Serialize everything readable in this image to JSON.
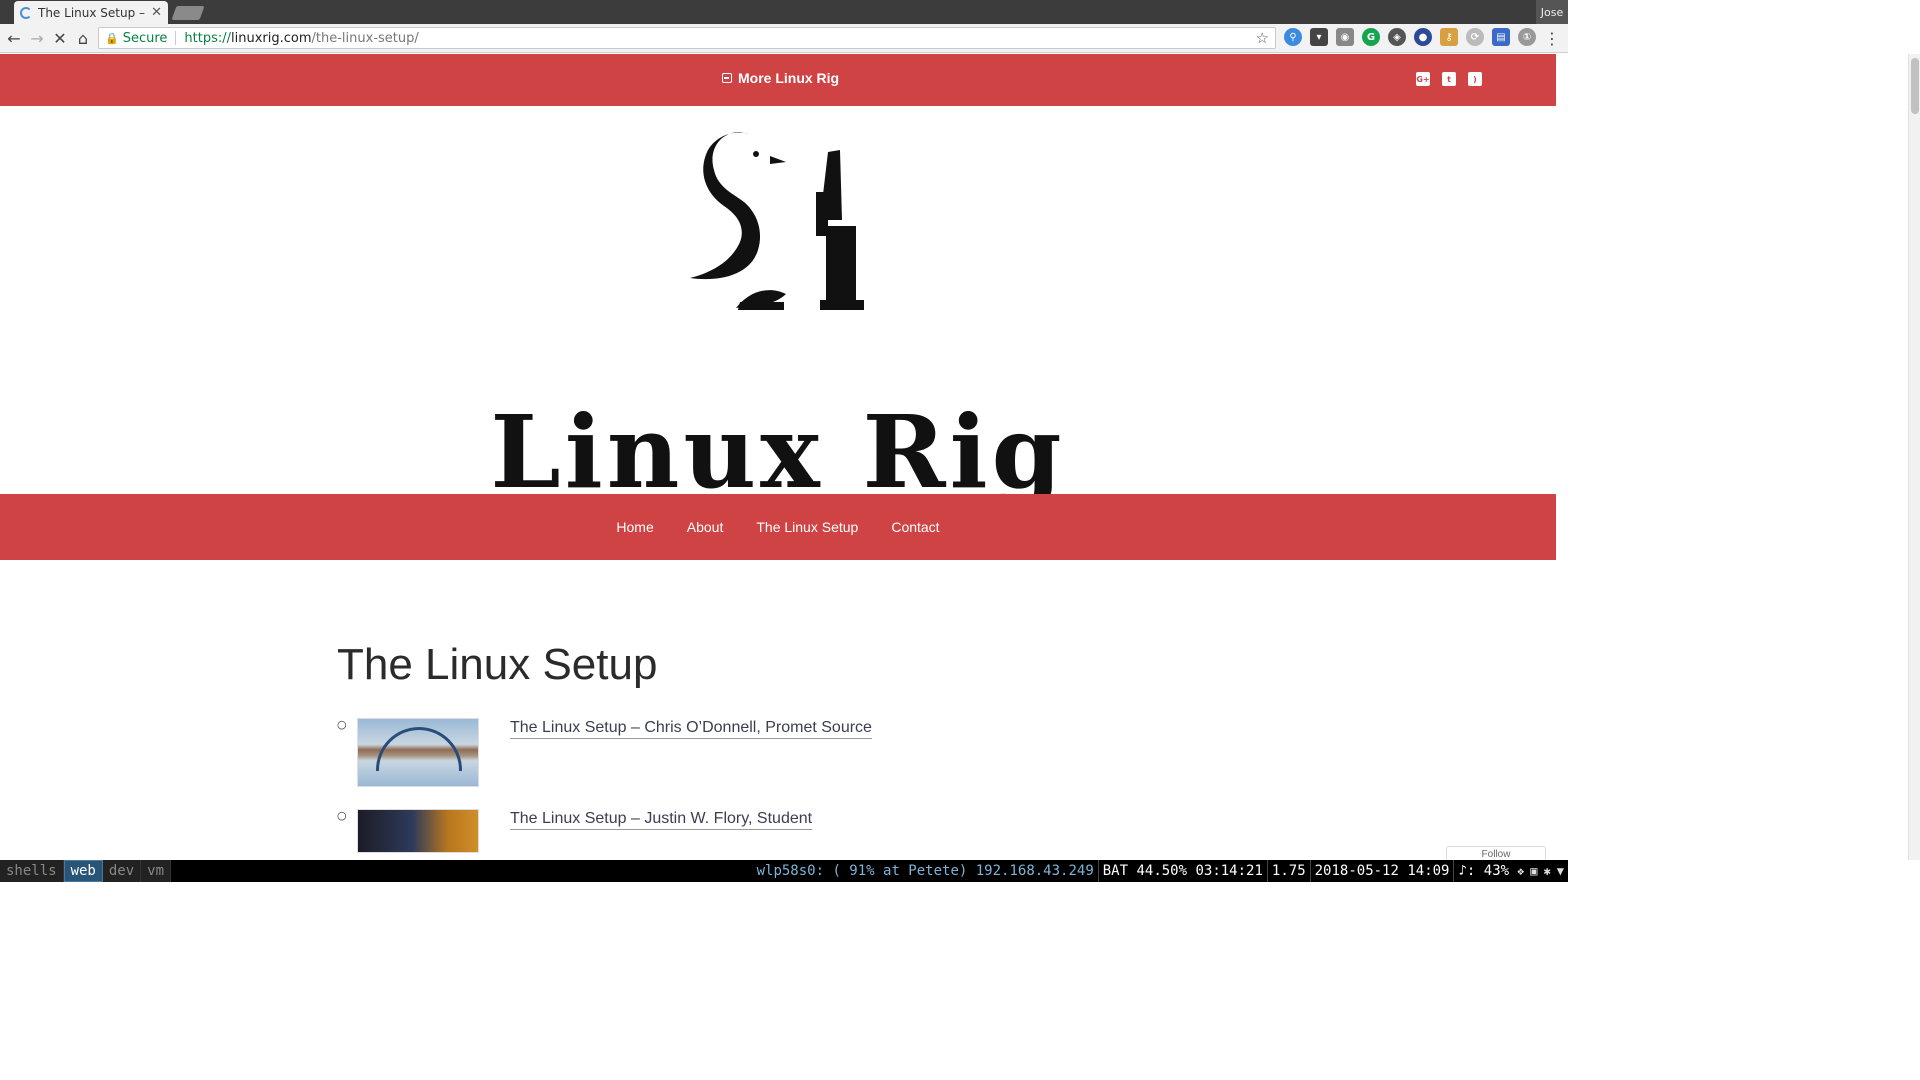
{
  "browser": {
    "tab_title": "The Linux Setup – Li",
    "profile_name": "Jose",
    "security_label": "Secure",
    "url_scheme": "https://",
    "url_host": "linuxrig.com",
    "url_path": "/the-linux-setup/"
  },
  "site": {
    "more_link": "More Linux Rig",
    "wordmark": "Linux Rig",
    "social_icons": [
      "google-plus-icon",
      "twitter-icon",
      "rss-icon"
    ],
    "nav": [
      "Home",
      "About",
      "The Linux Setup",
      "Contact"
    ],
    "accent_color": "#d04344"
  },
  "main": {
    "title": "The Linux Setup",
    "posts": [
      {
        "title": "The Linux Setup – Chris O’Donnell, Promet Source"
      },
      {
        "title": "The Linux Setup – Justin W. Flory, Student"
      }
    ],
    "follow_label": "Follow"
  },
  "statusbar": {
    "workspaces": [
      "shells",
      "web",
      "dev",
      "vm"
    ],
    "active_workspace": "web",
    "wifi": "wlp58s0: ( 91% at Petete) 192.168.43.249",
    "battery": "BAT 44.50% 03:14:21",
    "load": "1.75",
    "datetime": "2018-05-12 14:09",
    "volume": "♪: 43%"
  }
}
